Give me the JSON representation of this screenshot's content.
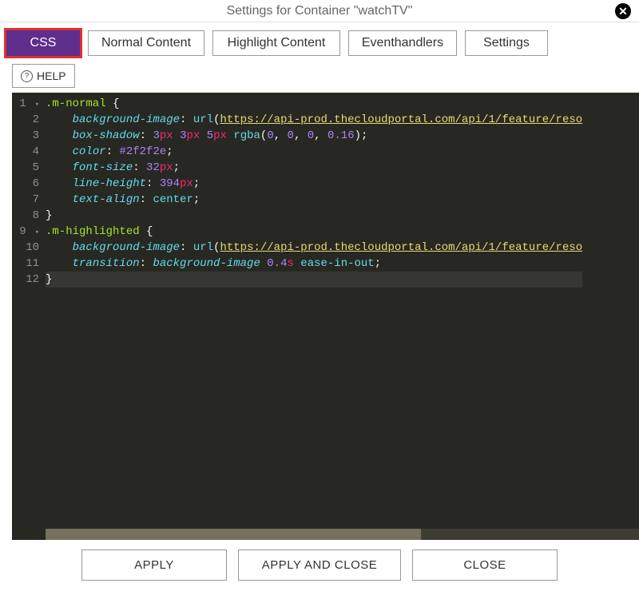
{
  "header": {
    "title": "Settings for Container \"watchTV\""
  },
  "tabs": {
    "css": "CSS",
    "normal": "Normal Content",
    "highlight": "Highlight Content",
    "event": "Eventhandlers",
    "settings": "Settings",
    "active": "css"
  },
  "help": {
    "label": "HELP"
  },
  "editor": {
    "line_numbers": [
      "1",
      "2",
      "3",
      "4",
      "5",
      "6",
      "7",
      "8",
      "9",
      "10",
      "11",
      "12"
    ],
    "lines": [
      {
        "sel": ".m-normal",
        "post": " {"
      },
      {
        "indent": "    ",
        "prop": "background-image",
        "after_prop": ": ",
        "func": "url",
        "paren_open": "(",
        "url": "https://api-prod.thecloudportal.com/api/1/feature/reso"
      },
      {
        "indent": "    ",
        "prop": "box-shadow",
        "after_prop": ": ",
        "tokens": [
          {
            "num": "3",
            "unit": "px"
          },
          " ",
          {
            "num": "3",
            "unit": "px"
          },
          " ",
          {
            "num": "5",
            "unit": "px"
          },
          " ",
          {
            "func": "rgba"
          },
          {
            "punc": "("
          },
          {
            "num": "0"
          },
          {
            "punc": ", "
          },
          {
            "num": "0"
          },
          {
            "punc": ", "
          },
          {
            "num": "0"
          },
          {
            "punc": ", "
          },
          {
            "num": "0.16"
          },
          {
            "punc": ")"
          },
          {
            "punc": ";"
          }
        ]
      },
      {
        "indent": "    ",
        "prop": "color",
        "after_prop": ": ",
        "hex": "#2f2f2e",
        "semi": ";"
      },
      {
        "indent": "    ",
        "prop": "font-size",
        "after_prop": ": ",
        "num": "32",
        "unit": "px",
        "semi": ";"
      },
      {
        "indent": "    ",
        "prop": "line-height",
        "after_prop": ": ",
        "num": "394",
        "unit": "px",
        "semi": ";"
      },
      {
        "indent": "    ",
        "prop": "text-align",
        "after_prop": ": ",
        "val": "center",
        "semi": ";"
      },
      {
        "close": "}"
      },
      {
        "sel": ".m-highlighted",
        "post": " {"
      },
      {
        "indent": "    ",
        "prop": "background-image",
        "after_prop": ": ",
        "func": "url",
        "paren_open": "(",
        "url": "https://api-prod.thecloudportal.com/api/1/feature/reso"
      },
      {
        "indent": "    ",
        "prop": "transition",
        "after_prop": ": ",
        "tokens": [
          {
            "ital": "background-image"
          },
          " ",
          {
            "num": "0.4",
            "unit": "s"
          },
          " ",
          {
            "val": "ease-in-out"
          },
          {
            "punc": ";"
          }
        ]
      },
      {
        "close": "}",
        "active": true
      }
    ]
  },
  "footer": {
    "apply": "APPLY",
    "apply_close": "APPLY AND CLOSE",
    "close": "CLOSE"
  }
}
